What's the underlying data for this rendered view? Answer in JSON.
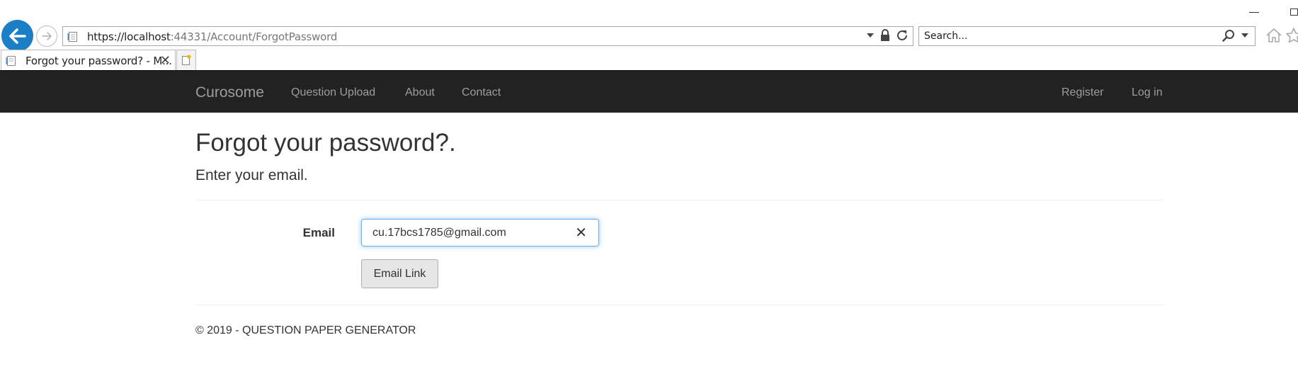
{
  "browser": {
    "address": {
      "scheme_host": "https://localhost",
      "port_path": ":44331/Account/ForgotPassword"
    },
    "search": {
      "placeholder": "Search..."
    },
    "tab": {
      "title": "Forgot your password? - M...",
      "close": "✕"
    }
  },
  "navbar": {
    "brand": "Curosome",
    "left_links": [
      "Question Upload",
      "About",
      "Contact"
    ],
    "right_links": [
      "Register",
      "Log in"
    ]
  },
  "page": {
    "title": "Forgot your password?.",
    "subtitle": "Enter your email.",
    "form": {
      "email_label": "Email",
      "email_value": "cu.17bcs1785@gmail.com",
      "clear_glyph": "✕",
      "submit_label": "Email Link"
    },
    "footer": "© 2019 - QUESTION PAPER GENERATOR"
  },
  "colors": {
    "navbar_bg": "#222222",
    "nav_text": "#9d9d9d",
    "back_button": "#1b7fc7",
    "focus_border": "#66afe9"
  },
  "icons": [
    "back-arrow-icon",
    "forward-arrow-icon",
    "page-icon",
    "dropdown-arrow-icon",
    "lock-icon",
    "refresh-icon",
    "search-icon",
    "home-icon",
    "favorites-star-icon",
    "new-tab-icon",
    "close-icon"
  ]
}
